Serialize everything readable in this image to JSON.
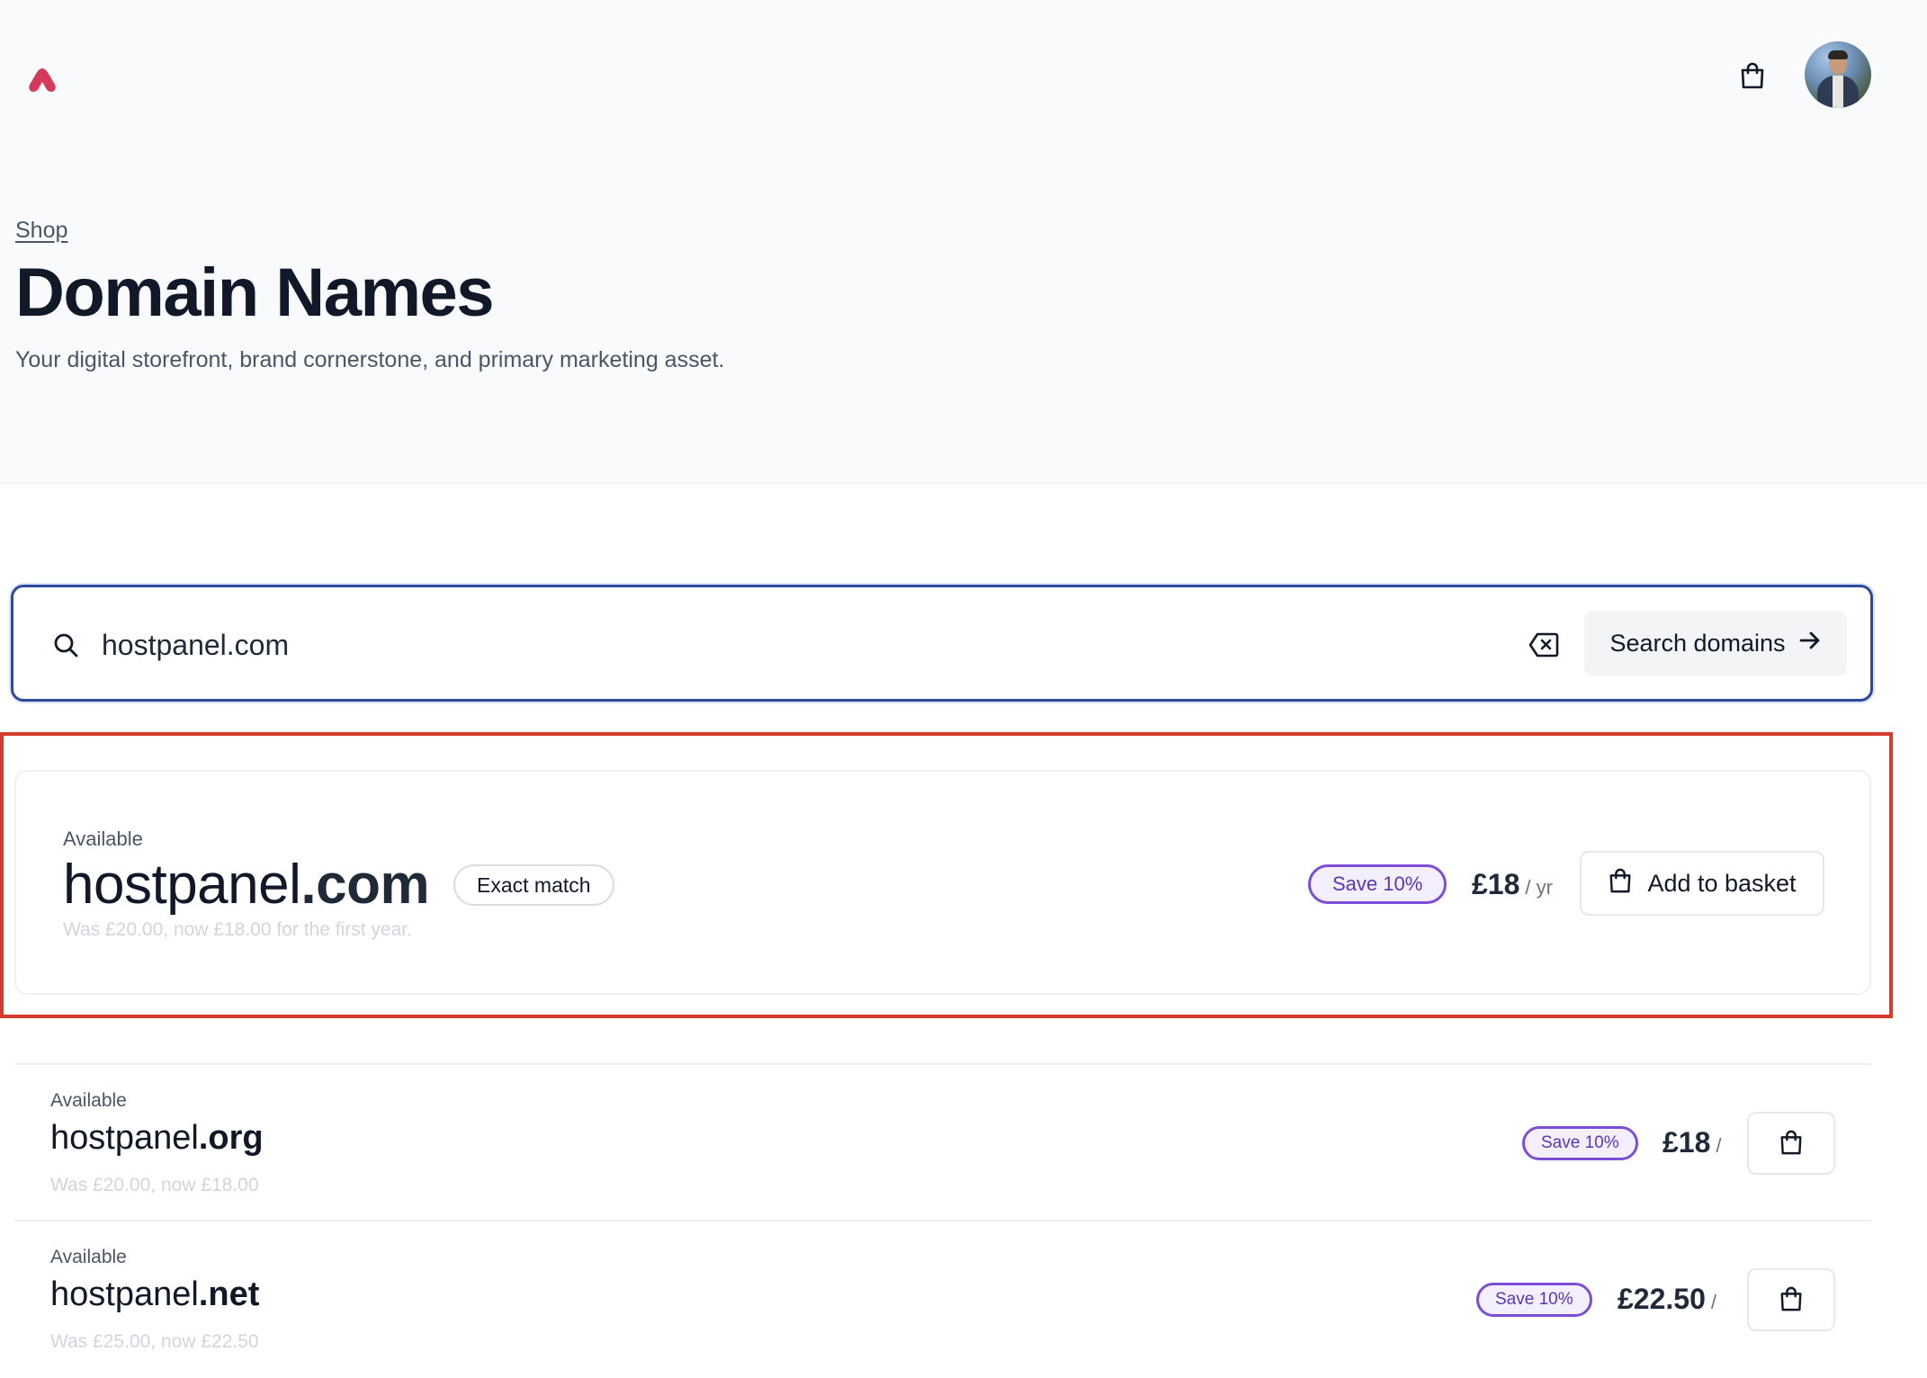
{
  "header": {
    "logo_icon": "brand-logo-icon",
    "cart_icon": "shopping-bag-icon",
    "avatar_icon": "user-avatar"
  },
  "page": {
    "breadcrumb": "Shop",
    "title": "Domain Names",
    "subtitle": "Your digital storefront, brand cornerstone, and primary marketing asset."
  },
  "search": {
    "value": "hostpanel.com",
    "button_label": "Search domains",
    "search_icon": "search-icon",
    "clear_icon": "clear-input-icon",
    "button_icon": "arrow-right-icon"
  },
  "featured": {
    "status": "Available",
    "name": "hostpanel",
    "tld": ".com",
    "badge": "Exact match",
    "note": "Was £20.00, now £18.00 for the first year.",
    "save": "Save 10%",
    "price": "£18",
    "period": "/ yr",
    "add_label": "Add to basket"
  },
  "results": [
    {
      "status": "Available",
      "name": "hostpanel",
      "tld": ".org",
      "note": "Was £20.00, now £18.00",
      "save": "Save 10%",
      "price": "£18",
      "period": "/"
    },
    {
      "status": "Available",
      "name": "hostpanel",
      "tld": ".net",
      "note": "Was £25.00, now £22.50",
      "save": "Save 10%",
      "price": "£22.50",
      "period": "/"
    }
  ],
  "colors": {
    "brand": "#d63a5a",
    "search_border": "#2f4a9c",
    "highlight": "#d63a2f",
    "save_badge": "#7c4dd6"
  }
}
